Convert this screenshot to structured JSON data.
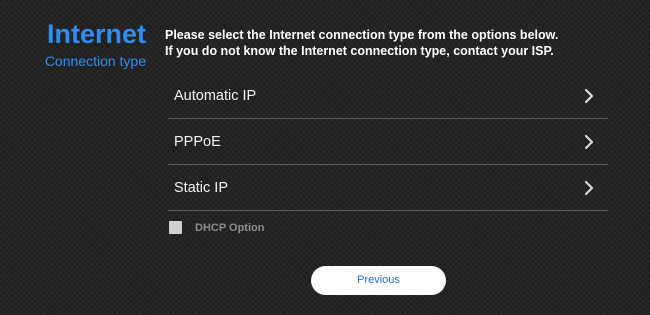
{
  "side": {
    "title": "Internet",
    "subtitle": "Connection type"
  },
  "instructions": {
    "line1": "Please select the Internet connection type from the options below.",
    "line2": "If you do not know the Internet connection type, contact your ISP."
  },
  "options": [
    {
      "label": "Automatic IP",
      "icon": "chevron-right-icon"
    },
    {
      "label": "PPPoE",
      "icon": "chevron-right-icon"
    },
    {
      "label": "Static IP",
      "icon": "chevron-right-icon"
    }
  ],
  "dhcp_option": {
    "label": "DHCP Option",
    "checked": false
  },
  "buttons": {
    "previous": "Previous"
  },
  "colors": {
    "accent": "#2f8cf0",
    "button_text": "#1f6fd1",
    "background": "#232323",
    "divider": "#5a5a5a"
  }
}
